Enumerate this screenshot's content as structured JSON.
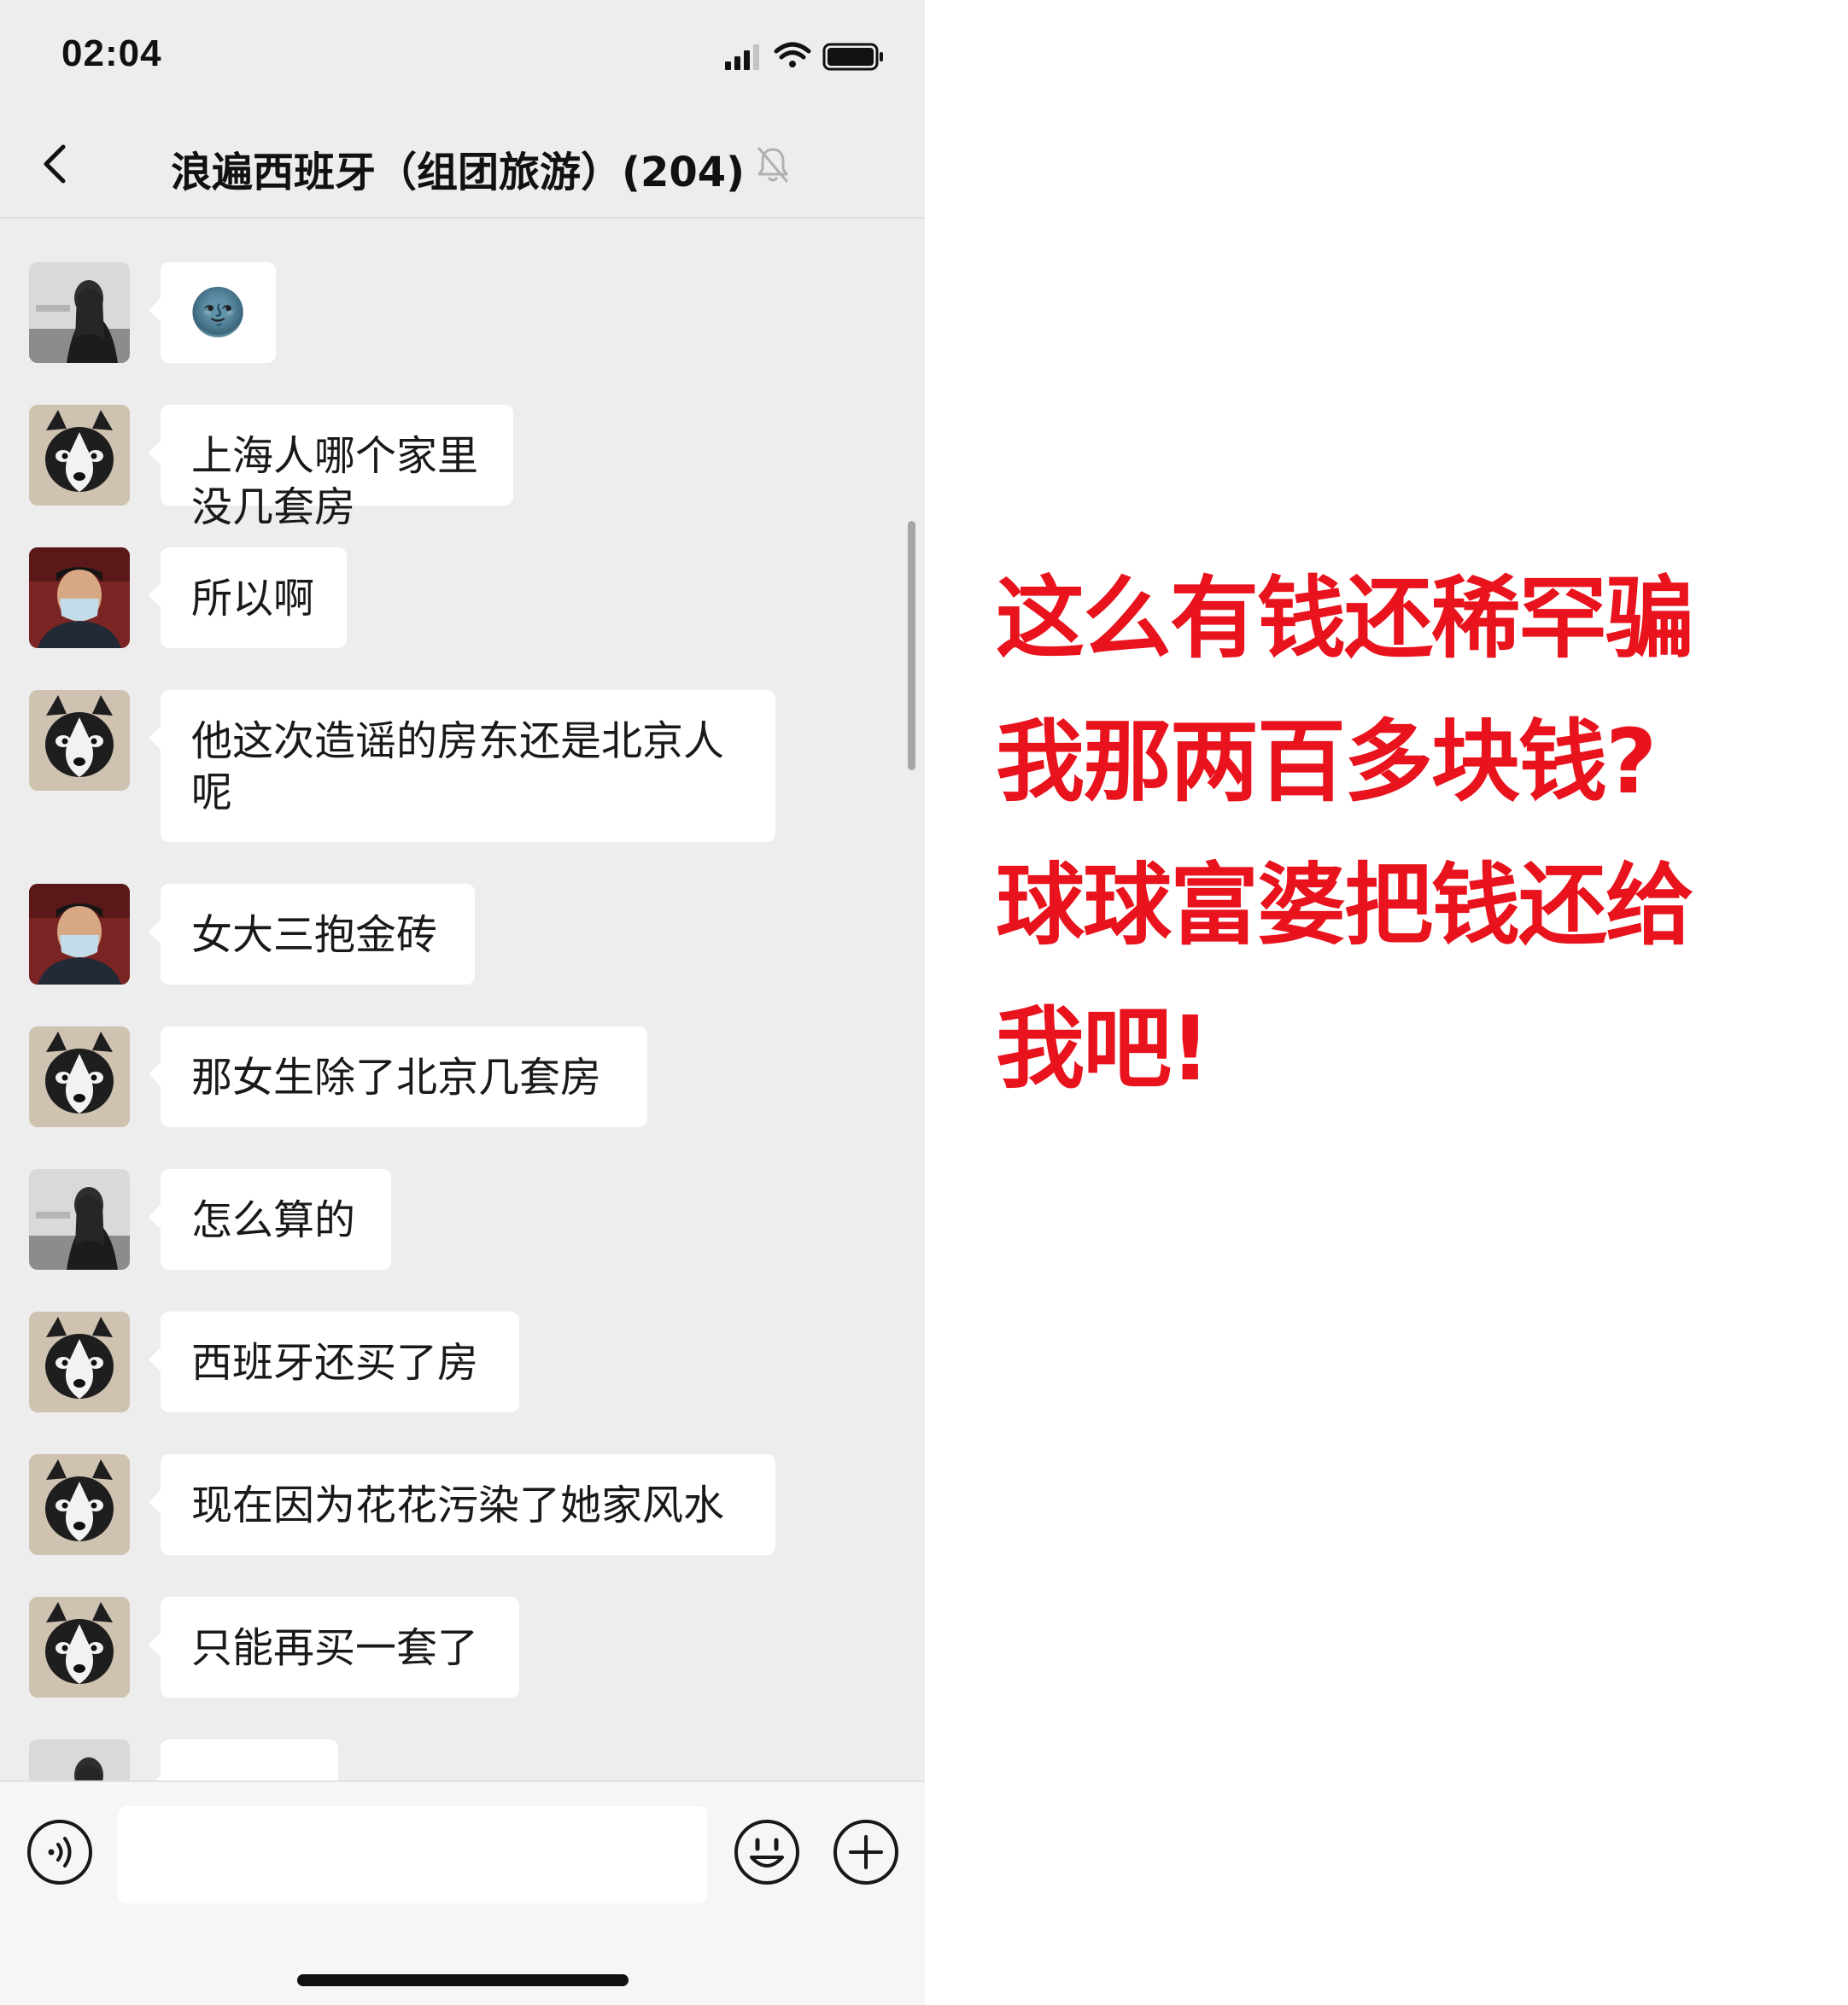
{
  "status_bar": {
    "time": "02:04"
  },
  "header": {
    "title": "浪遍西班牙（组团旅游）(204)"
  },
  "messages": [
    {
      "sender": "woman",
      "text": "🌚"
    },
    {
      "sender": "husky",
      "text": "上海人哪个家里没几套房"
    },
    {
      "sender": "man",
      "text": "所以啊"
    },
    {
      "sender": "husky",
      "text": "他这次造谣的房东还是北京人呢"
    },
    {
      "sender": "man",
      "text": "女大三抱金砖"
    },
    {
      "sender": "husky",
      "text": "那女生除了北京几套房"
    },
    {
      "sender": "woman",
      "text": "怎么算的"
    },
    {
      "sender": "husky",
      "text": "西班牙还买了房"
    },
    {
      "sender": "husky",
      "text": "现在因为花花污染了她家风水"
    },
    {
      "sender": "husky",
      "text": "只能再买一套了"
    }
  ],
  "input": {
    "placeholder": ""
  },
  "caption": {
    "lines": [
      "这么有钱还稀罕骗",
      "我那两百多块钱?",
      "球球富婆把钱还给",
      "我吧!"
    ],
    "color": "#e8131d"
  },
  "colors": {
    "chat_bg": "#ededed",
    "bubble": "#ffffff"
  }
}
